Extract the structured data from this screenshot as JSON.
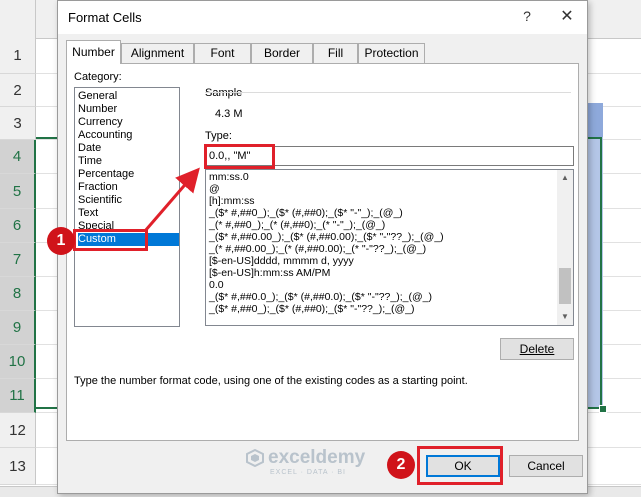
{
  "sheet": {
    "row_numbers": [
      "1",
      "2",
      "3",
      "4",
      "5",
      "6",
      "7",
      "8",
      "9",
      "10",
      "11",
      "12",
      "13"
    ]
  },
  "dialog": {
    "title": "Format Cells",
    "help_label": "?",
    "close_label": "✕",
    "tabs": [
      {
        "label": "Number"
      },
      {
        "label": "Alignment"
      },
      {
        "label": "Font"
      },
      {
        "label": "Border"
      },
      {
        "label": "Fill"
      },
      {
        "label": "Protection"
      }
    ],
    "category_label": "Category:",
    "categories": [
      {
        "label": "General"
      },
      {
        "label": "Number"
      },
      {
        "label": "Currency"
      },
      {
        "label": "Accounting"
      },
      {
        "label": "Date"
      },
      {
        "label": "Time"
      },
      {
        "label": "Percentage"
      },
      {
        "label": "Fraction"
      },
      {
        "label": "Scientific"
      },
      {
        "label": "Text"
      },
      {
        "label": "Special"
      },
      {
        "label": "Custom"
      }
    ],
    "selected_category": "Custom",
    "sample_label": "Sample",
    "sample_value": "4.3 M",
    "type_label": "Type:",
    "type_value": "0.0,, \"M\"",
    "format_codes": [
      {
        "code": "mm:ss.0"
      },
      {
        "code": "@"
      },
      {
        "code": "[h]:mm:ss"
      },
      {
        "code": "_($* #,##0_);_($* (#,##0);_($* \"-\"_);_(@_)"
      },
      {
        "code": "_(* #,##0_);_(* (#,##0);_(* \"-\"_);_(@_)"
      },
      {
        "code": "_($* #,##0.00_);_($* (#,##0.00);_($* \"-\"??_);_(@_)"
      },
      {
        "code": "_(* #,##0.00_);_(* (#,##0.00);_(* \"-\"??_);_(@_)"
      },
      {
        "code": "[$-en-US]dddd, mmmm d, yyyy"
      },
      {
        "code": "[$-en-US]h:mm:ss AM/PM"
      },
      {
        "code": "0.0"
      },
      {
        "code": "_($* #,##0.0_);_($* (#,##0.0);_($* \"-\"??_);_(@_)"
      },
      {
        "code": "_($* #,##0_);_($* (#,##0);_($* \"-\"??_);_(@_)"
      }
    ],
    "delete_label": "Delete",
    "hint_text": "Type the number format code, using one of the existing codes as a starting point.",
    "ok_label": "OK",
    "cancel_label": "Cancel"
  },
  "annotations": {
    "badge_1": "1",
    "badge_2": "2",
    "color": "#e0202a"
  },
  "watermark": {
    "name": "exceldemy",
    "tagline": "EXCEL · DATA · BI"
  },
  "colors": {
    "accent": "#0078d7",
    "excel_green": "#217346"
  }
}
